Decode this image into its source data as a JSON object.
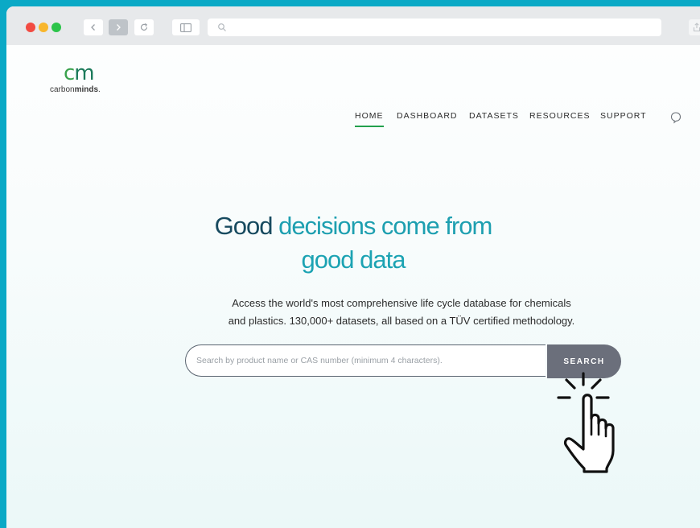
{
  "browser": {
    "traffic_lights": [
      "#f24b42",
      "#f8b62c",
      "#2cc44a"
    ],
    "url_placeholder": ""
  },
  "logo": {
    "mark_c": "c",
    "mark_m": "m",
    "word_light": "carbon",
    "word_bold": "minds",
    "word_suffix": ".",
    "colors": {
      "c": "#3aa24e",
      "m": "#1b7a5a"
    }
  },
  "nav": {
    "items": [
      {
        "label": "HOME",
        "active": true
      },
      {
        "label": "DASHBOARD",
        "active": false
      },
      {
        "label": "DATASETS",
        "active": false
      },
      {
        "label": "RESOURCES",
        "active": false
      },
      {
        "label": "SUPPORT",
        "active": false
      }
    ],
    "active_underline_color": "#23a04d",
    "chat_icon": "chat-bubble-icon"
  },
  "hero": {
    "headline_part1": "Good ",
    "headline_part2": "decisions come from",
    "headline_line2": "good data",
    "colors": {
      "dark": "#174a5f",
      "teal": "#1d9fb0"
    },
    "subtext_line1": "Access the world's most comprehensive life cycle database for chemicals",
    "subtext_line2": "and plastics. 130,000+ datasets, all based on a TÜV certified methodology."
  },
  "search": {
    "placeholder": "Search by product name or CAS number (minimum 4 characters).",
    "value": "",
    "button_label": "SEARCH",
    "button_color": "#6b6f7b"
  },
  "cursor_icon": "pointing-hand-click-icon"
}
